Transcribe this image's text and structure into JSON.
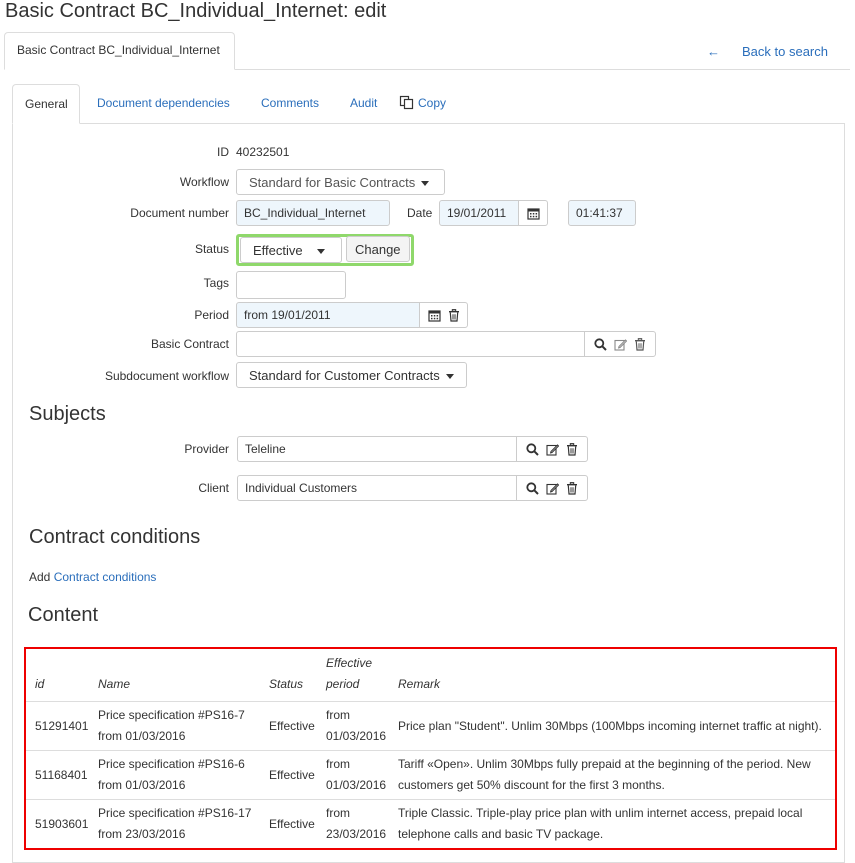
{
  "page": {
    "title": "Basic Contract BC_Individual_Internet: edit",
    "outer_tab": "Basic Contract BC_Individual_Internet",
    "back_link": "Back to search"
  },
  "tabs": {
    "general": "General",
    "document_dependencies": "Document dependencies",
    "comments": "Comments",
    "audit": "Audit",
    "copy": "Copy"
  },
  "form": {
    "id_label": "ID",
    "id_value": "40232501",
    "workflow_label": "Workflow",
    "workflow_value": "Standard for Basic Contracts",
    "docnum_label": "Document number",
    "docnum_value": "BC_Individual_Internet",
    "date_label": "Date",
    "date_value": "19/01/2011",
    "time_value": "01:41:37",
    "status_label": "Status",
    "status_value": "Effective",
    "change_button": "Change",
    "tags_label": "Tags",
    "tags_value": "",
    "period_label": "Period",
    "period_value": "from 19/01/2011",
    "basic_contract_label": "Basic Contract",
    "basic_contract_value": "",
    "subdoc_workflow_label": "Subdocument workflow",
    "subdoc_workflow_value": "Standard for Customer Contracts"
  },
  "subjects": {
    "title": "Subjects",
    "provider_label": "Provider",
    "provider_value": "Teleline",
    "client_label": "Client",
    "client_value": "Individual Customers"
  },
  "conditions": {
    "title": "Contract conditions",
    "add_prefix": "Add",
    "add_link": "Contract conditions"
  },
  "content": {
    "title": "Content",
    "headers": {
      "id": "id",
      "name": "Name",
      "status": "Status",
      "period_line1": "Effective",
      "period_line2": "period",
      "remark": "Remark"
    },
    "rows": [
      {
        "id": "51291401",
        "name1": "Price specification #PS16-7",
        "name2": "from 01/03/2016",
        "status": "Effective",
        "period1": "from",
        "period2": "01/03/2016",
        "remark1": "Price plan \"Student\". Unlim 30Mbps (100Mbps incoming internet traffic at night).",
        "remark2": ""
      },
      {
        "id": "51168401",
        "name1": "Price specification #PS16-6",
        "name2": "from 01/03/2016",
        "status": "Effective",
        "period1": "from",
        "period2": "01/03/2016",
        "remark1": "Tariff «Open». Unlim 30Mbps fully prepaid at the beginning of the period. New",
        "remark2": "customers get 50% discount for the first 3 months."
      },
      {
        "id": "51903601",
        "name1": "Price specification #PS16-17",
        "name2": "from 23/03/2016",
        "status": "Effective",
        "period1": "from",
        "period2": "23/03/2016",
        "remark1": "Triple Classic. Triple-play price plan with unlim internet access, prepaid local",
        "remark2": "telephone calls and basic TV package."
      }
    ]
  },
  "colors": {
    "link": "#2a6ebb",
    "status_highlight": "#8fd86b",
    "content_outline": "#ee0000"
  }
}
